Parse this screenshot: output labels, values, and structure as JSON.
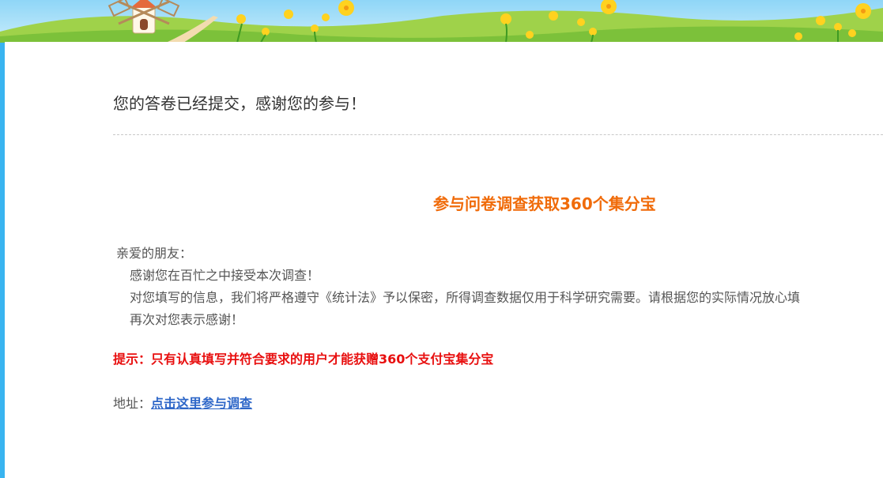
{
  "submitted_message": "您的答卷已经提交，感谢您的参与！",
  "promo_title": "参与问卷调查获取360个集分宝",
  "letter": {
    "greeting": "亲爱的朋友：",
    "line1": "感谢您在百忙之中接受本次调查！",
    "line2": "对您填写的信息，我们将严格遵守《统计法》予以保密，所得调查数据仅用于科学研究需要。请根据您的实际情况放心填",
    "line3": "再次对您表示感谢！"
  },
  "tip": "提示：只有认真填写并符合要求的用户才能获赠360个支付宝集分宝",
  "address": {
    "label": "地址：",
    "link_text": "点击这里参与调查"
  },
  "colors": {
    "page_bg": "#39b4f0",
    "promo_title": "#f06b0a",
    "tip": "#e80f0f",
    "link": "#2e67c8"
  }
}
